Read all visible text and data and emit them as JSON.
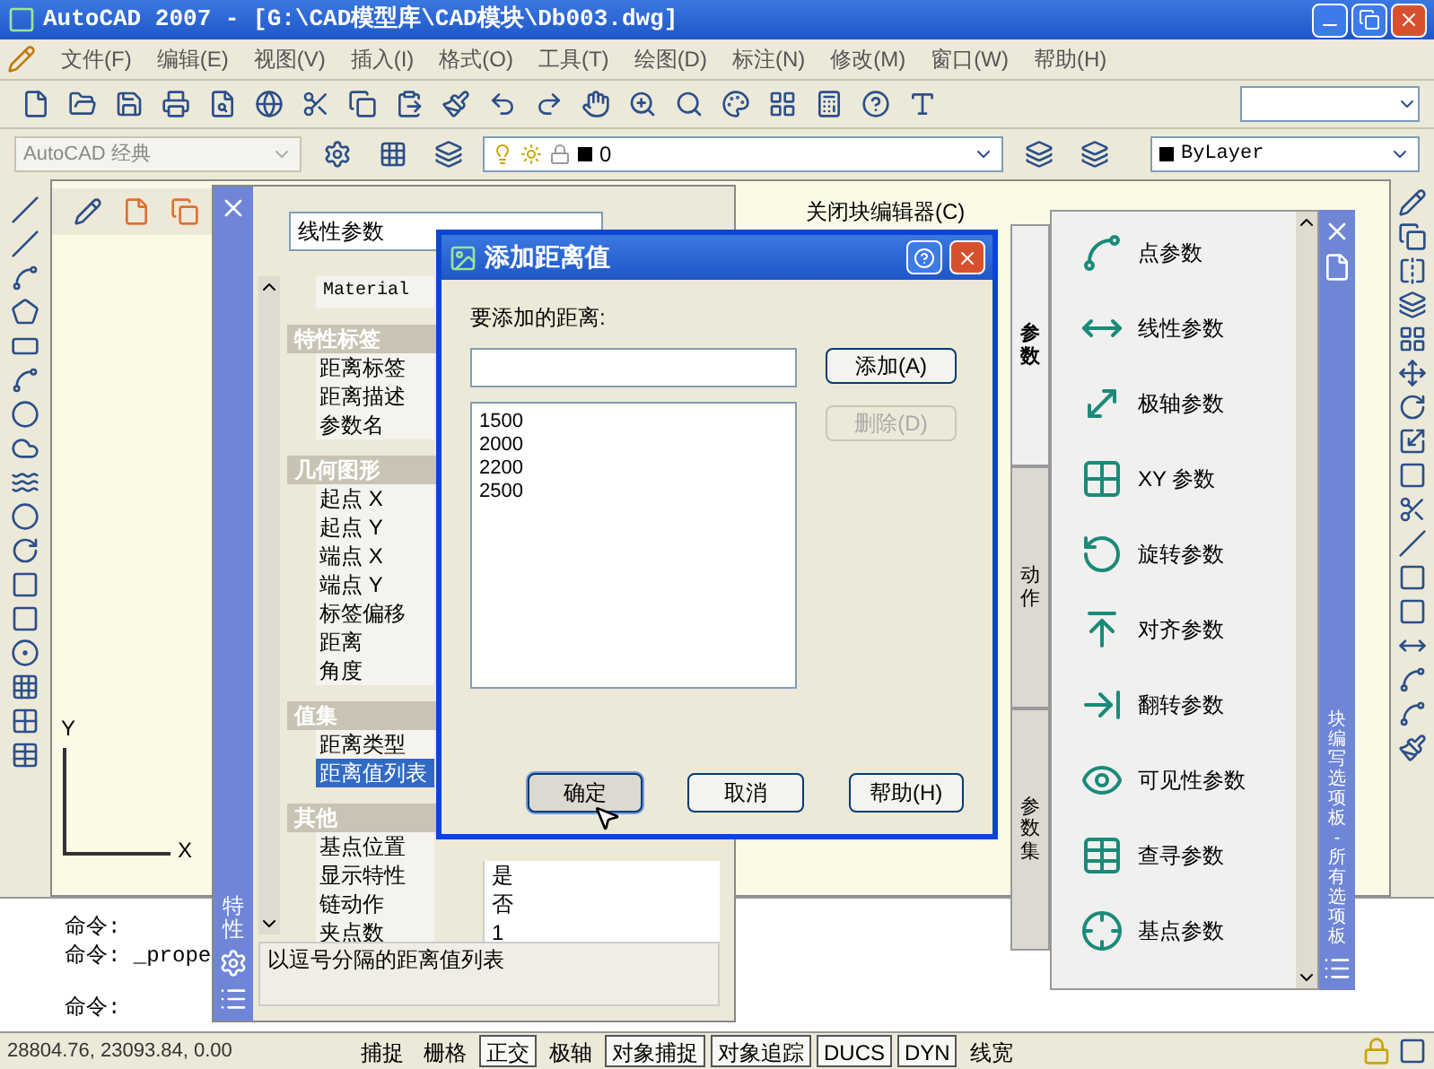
{
  "window": {
    "title": "AutoCAD 2007 - [G:\\CAD模型库\\CAD模块\\Db003.dwg]"
  },
  "menu": [
    {
      "label": "文件(F)"
    },
    {
      "label": "编辑(E)"
    },
    {
      "label": "视图(V)"
    },
    {
      "label": "插入(I)"
    },
    {
      "label": "格式(O)"
    },
    {
      "label": "工具(T)"
    },
    {
      "label": "绘图(D)"
    },
    {
      "label": "标注(N)"
    },
    {
      "label": "修改(M)"
    },
    {
      "label": "窗口(W)"
    },
    {
      "label": "帮助(H)"
    }
  ],
  "workspace": {
    "value": "AutoCAD 经典"
  },
  "layer": {
    "value": "0"
  },
  "color_control": {
    "value": "ByLayer"
  },
  "block_editor": {
    "close_label": "关闭块编辑器(C)"
  },
  "ucs": {
    "x_label": "X",
    "y_label": "Y"
  },
  "properties": {
    "title": "特性",
    "object_type": "线性参数",
    "rows": [
      {
        "kind": "field",
        "label": "Material"
      },
      {
        "kind": "category",
        "label": "特性标签"
      },
      {
        "kind": "property",
        "label": "距离标签",
        "selected": false
      },
      {
        "kind": "property",
        "label": "距离描述",
        "selected": false
      },
      {
        "kind": "property",
        "label": "参数名",
        "selected": false
      },
      {
        "kind": "category",
        "label": "几何图形"
      },
      {
        "kind": "property",
        "label": "起点 X",
        "selected": false
      },
      {
        "kind": "property",
        "label": "起点 Y",
        "selected": false
      },
      {
        "kind": "property",
        "label": "端点 X",
        "selected": false
      },
      {
        "kind": "property",
        "label": "端点 Y",
        "selected": false
      },
      {
        "kind": "property",
        "label": "标签偏移",
        "selected": false
      },
      {
        "kind": "property",
        "label": "距离",
        "selected": false
      },
      {
        "kind": "property",
        "label": "角度",
        "selected": false
      },
      {
        "kind": "category",
        "label": "值集"
      },
      {
        "kind": "property",
        "label": "距离类型",
        "selected": false
      },
      {
        "kind": "property",
        "label": "距离值列表",
        "selected": true
      },
      {
        "kind": "category",
        "label": "其他"
      },
      {
        "kind": "property",
        "label": "基点位置",
        "selected": false
      },
      {
        "kind": "property",
        "label": "显示特性",
        "value": "是",
        "selected": false
      },
      {
        "kind": "property",
        "label": "链动作",
        "value": "否",
        "selected": false
      },
      {
        "kind": "property",
        "label": "夹点数",
        "value": "1",
        "selected": false
      }
    ],
    "description": "以逗号分隔的距离值列表"
  },
  "dialog": {
    "title": "添加距离值",
    "field_label": "要添加的距离:",
    "values": [
      "1500",
      "2000",
      "2200",
      "2500"
    ],
    "side_buttons": [
      {
        "label": "添加(A)",
        "disabled": false
      },
      {
        "label": "删除(D)",
        "disabled": true
      }
    ],
    "buttons": [
      {
        "label": "确定",
        "focused": true
      },
      {
        "label": "取消",
        "focused": false
      },
      {
        "label": "帮助(H)",
        "focused": false
      }
    ]
  },
  "palette": {
    "title": "块编写选项板 - 所有选项板",
    "tabs": [
      {
        "label": "参数",
        "selected": true
      },
      {
        "label": "动作",
        "selected": false
      },
      {
        "label": "参数集",
        "selected": false
      }
    ],
    "items": [
      {
        "label": "点参数"
      },
      {
        "label": "线性参数"
      },
      {
        "label": "极轴参数"
      },
      {
        "label": "XY 参数"
      },
      {
        "label": "旋转参数"
      },
      {
        "label": "对齐参数"
      },
      {
        "label": "翻转参数"
      },
      {
        "label": "可见性参数"
      },
      {
        "label": "查寻参数"
      },
      {
        "label": "基点参数"
      }
    ]
  },
  "command": {
    "lines": [
      "命令:",
      "命令: _prope"
    ],
    "prompt": "命令:"
  },
  "status_bar": {
    "coordinates": "28804.76, 23093.84, 0.00",
    "buttons": [
      {
        "label": "捕捉",
        "on": false
      },
      {
        "label": "栅格",
        "on": false
      },
      {
        "label": "正交",
        "on": true
      },
      {
        "label": "极轴",
        "on": false
      },
      {
        "label": "对象捕捉",
        "on": true
      },
      {
        "label": "对象追踪",
        "on": true
      },
      {
        "label": "DUCS",
        "on": true
      },
      {
        "label": "DYN",
        "on": true
      },
      {
        "label": "线宽",
        "on": false
      }
    ]
  }
}
